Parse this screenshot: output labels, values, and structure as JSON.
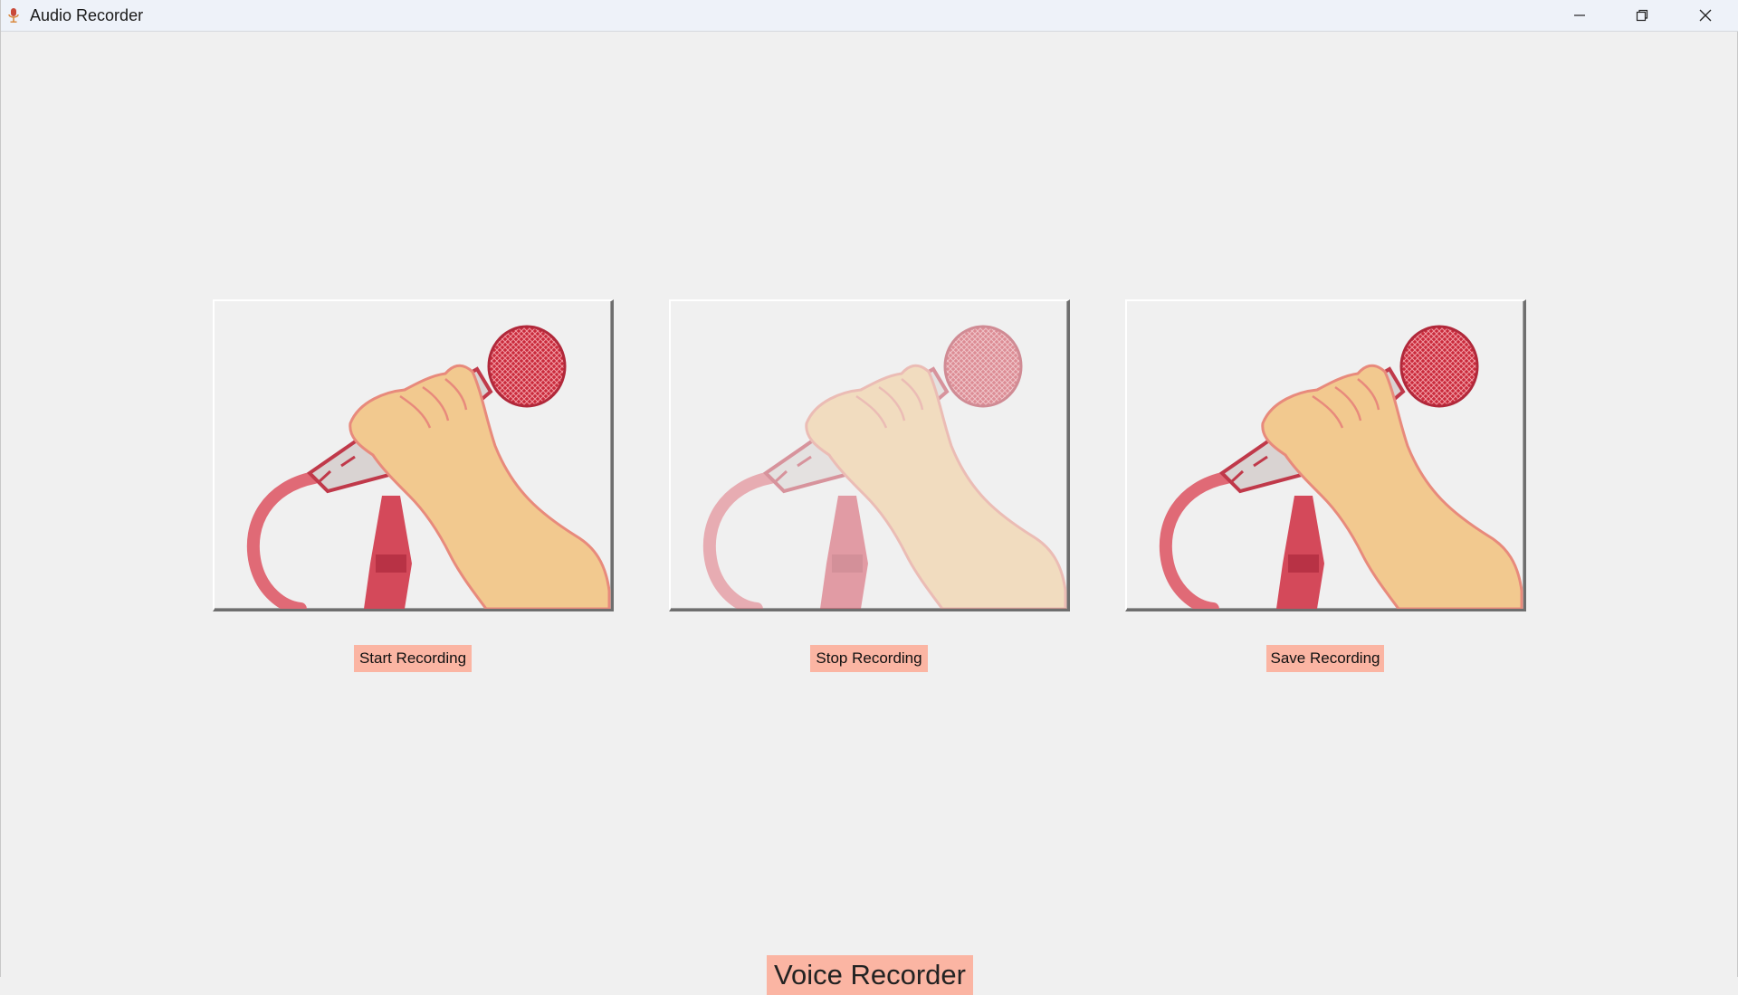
{
  "window": {
    "title": "Audio Recorder",
    "icon": "microphone-icon",
    "controls": [
      "minimize-icon",
      "restore-icon",
      "close-icon"
    ]
  },
  "buttons": [
    {
      "label": "Start Recording",
      "icon": "microphone-hand-icon",
      "state": "enabled"
    },
    {
      "label": "Stop Recording",
      "icon": "microphone-hand-icon",
      "state": "disabled"
    },
    {
      "label": "Save Recording",
      "icon": "microphone-hand-icon",
      "state": "enabled"
    }
  ],
  "footer": {
    "title": "Voice Recorder"
  },
  "colors": {
    "label_bg": "#fbb5a3",
    "window_bg": "#f0f0f0",
    "titlebar_bg": "#eef2f9",
    "mic_red": "#d94455",
    "skin": "#f2c98f"
  }
}
